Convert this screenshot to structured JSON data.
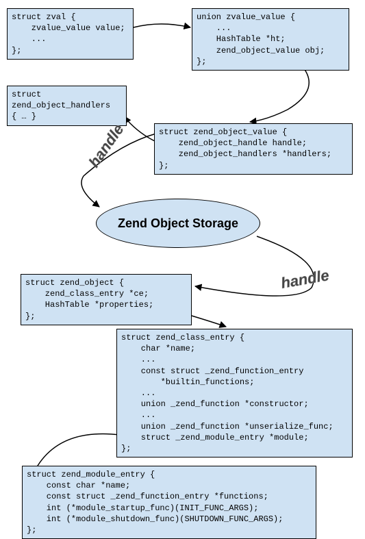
{
  "boxes": {
    "zval": "struct zval {\n    zvalue_value value;\n    ...\n};",
    "zvalue_value": "union zvalue_value {\n    ...\n    HashTable *ht;\n    zend_object_value obj;\n};",
    "zend_object_handlers": "struct\nzend_object_handlers\n{ … }",
    "zend_object_value": "struct zend_object_value {\n    zend_object_handle handle;\n    zend_object_handlers *handlers;\n};",
    "zend_object": "struct zend_object {\n    zend_class_entry *ce;\n    HashTable *properties;\n};",
    "zend_class_entry": "struct zend_class_entry {\n    char *name;\n    ...\n    const struct _zend_function_entry\n        *builtin_functions;\n    ...\n    union _zend_function *constructor;\n    ...\n    union _zend_function *unserialize_func;\n    struct _zend_module_entry *module;\n};",
    "zend_module_entry": "struct zend_module_entry {\n    const char *name;\n    const struct _zend_function_entry *functions;\n    int (*module_startup_func)(INIT_FUNC_ARGS);\n    int (*module_shutdown_func)(SHUTDOWN_FUNC_ARGS);\n};"
  },
  "storage_label": "Zend Object Storage",
  "handle_label": "handle"
}
